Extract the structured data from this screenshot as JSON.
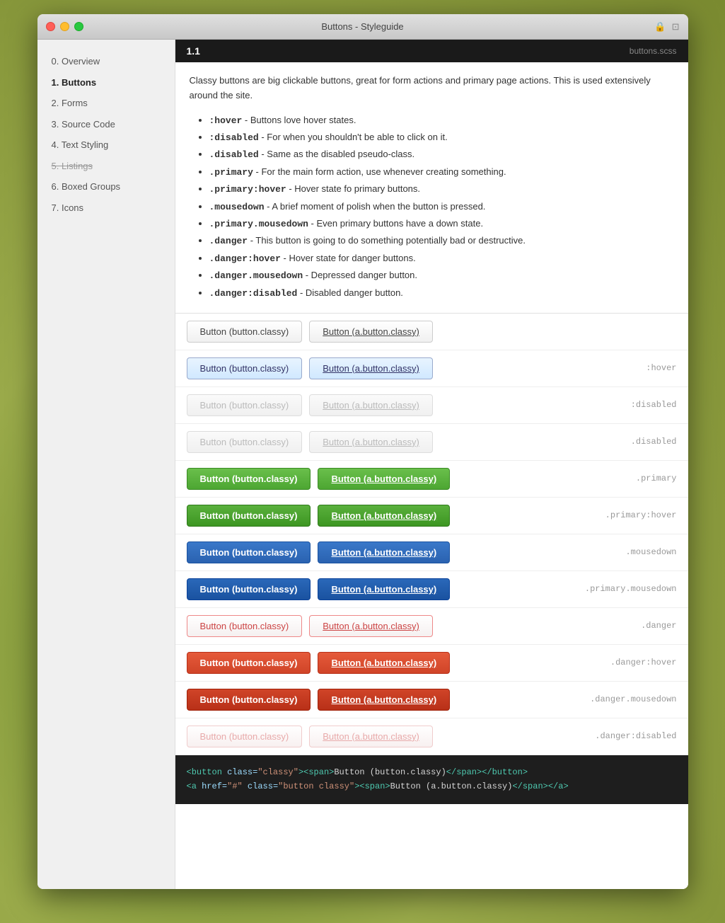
{
  "window": {
    "title": "Buttons - Styleguide"
  },
  "sidebar": {
    "items": [
      {
        "label": "0. Overview",
        "state": "normal"
      },
      {
        "label": "1. Buttons",
        "state": "active"
      },
      {
        "label": "2. Forms",
        "state": "normal"
      },
      {
        "label": "3. Source Code",
        "state": "normal"
      },
      {
        "label": "4. Text Styling",
        "state": "normal"
      },
      {
        "label": "5. Listings",
        "state": "strikethrough"
      },
      {
        "label": "6. Boxed Groups",
        "state": "normal"
      },
      {
        "label": "7. Icons",
        "state": "normal"
      }
    ]
  },
  "section": {
    "number": "1.1",
    "file": "buttons.scss",
    "description": "Classy buttons are big clickable buttons, great for form actions and primary page actions. This is used extensively around the site.",
    "bullets": [
      {
        ":hover": ":hover",
        "text": " - Buttons love hover states."
      },
      {
        ":hover": ":disabled",
        "text": " - For when you shouldn't be able to click on it."
      },
      {
        ":hover": ".disabled",
        "text": " - Same as the disabled pseudo-class."
      },
      {
        ":hover": ".primary",
        "text": " - For the main form action, use whenever creating something."
      },
      {
        ":hover": ".primary:hover",
        "text": " - Hover state fo primary buttons."
      },
      {
        ":hover": ".mousedown",
        "text": " - A brief moment of polish when the button is pressed."
      },
      {
        ":hover": ".primary.mousedown",
        "text": " - Even primary buttons have a down state."
      },
      {
        ":hover": ".danger",
        "text": " - This button is going to do something potentially bad or destructive."
      },
      {
        ":hover": ".danger:hover",
        "text": " - Hover state for danger buttons."
      },
      {
        ":hover": ".danger.mousedown",
        "text": " - Depressed danger button."
      },
      {
        ":hover": ".danger:disabled",
        "text": " - Disabled danger button."
      }
    ]
  },
  "demo_rows": [
    {
      "btn1": "Button (button.classy)",
      "btn2": "Button (a.button.classy)",
      "state_label": "",
      "style1": "default",
      "style2": "default"
    },
    {
      "btn1": "Button (button.classy)",
      "btn2": "Button (a.button.classy)",
      "state_label": ":hover",
      "style1": "hover",
      "style2": "hover"
    },
    {
      "btn1": "Button (button.classy)",
      "btn2": "Button (a.button.classy)",
      "state_label": ":disabled",
      "style1": "disabled",
      "style2": "disabled"
    },
    {
      "btn1": "Button (button.classy)",
      "btn2": "Button (a.button.classy)",
      "state_label": ".disabled",
      "style1": "disabled-class",
      "style2": "disabled-class"
    },
    {
      "btn1": "Button (button.classy)",
      "btn2": "Button (a.button.classy)",
      "state_label": ".primary",
      "style1": "primary",
      "style2": "primary"
    },
    {
      "btn1": "Button (button.classy)",
      "btn2": "Button (a.button.classy)",
      "state_label": ".primary:hover",
      "style1": "primary-hover",
      "style2": "primary-hover"
    },
    {
      "btn1": "Button (button.classy)",
      "btn2": "Button (a.button.classy)",
      "state_label": ".mousedown",
      "style1": "mousedown",
      "style2": "mousedown"
    },
    {
      "btn1": "Button (button.classy)",
      "btn2": "Button (a.button.classy)",
      "state_label": ".primary.mousedown",
      "style1": "primary-mousedown",
      "style2": "primary-mousedown"
    },
    {
      "btn1": "Button (button.classy)",
      "btn2": "Button (a.button.classy)",
      "state_label": ".danger",
      "style1": "danger",
      "style2": "danger"
    },
    {
      "btn1": "Button (button.classy)",
      "btn2": "Button (a.button.classy)",
      "state_label": ".danger:hover",
      "style1": "danger-hover",
      "style2": "danger-hover"
    },
    {
      "btn1": "Button (button.classy)",
      "btn2": "Button (a.button.classy)",
      "state_label": ".danger.mousedown",
      "style1": "danger-mousedown",
      "style2": "danger-mousedown"
    },
    {
      "btn1": "Button (button.classy)",
      "btn2": "Button (a.button.classy)",
      "state_label": ".danger:disabled",
      "style1": "danger-disabled",
      "style2": "danger-disabled"
    }
  ],
  "code_lines": [
    "<button class=\"classy\"><span>Button (button.classy)</span></button>",
    "<a href=\"#\" class=\"button classy\"><span>Button (a.button.classy)</span></a>"
  ]
}
